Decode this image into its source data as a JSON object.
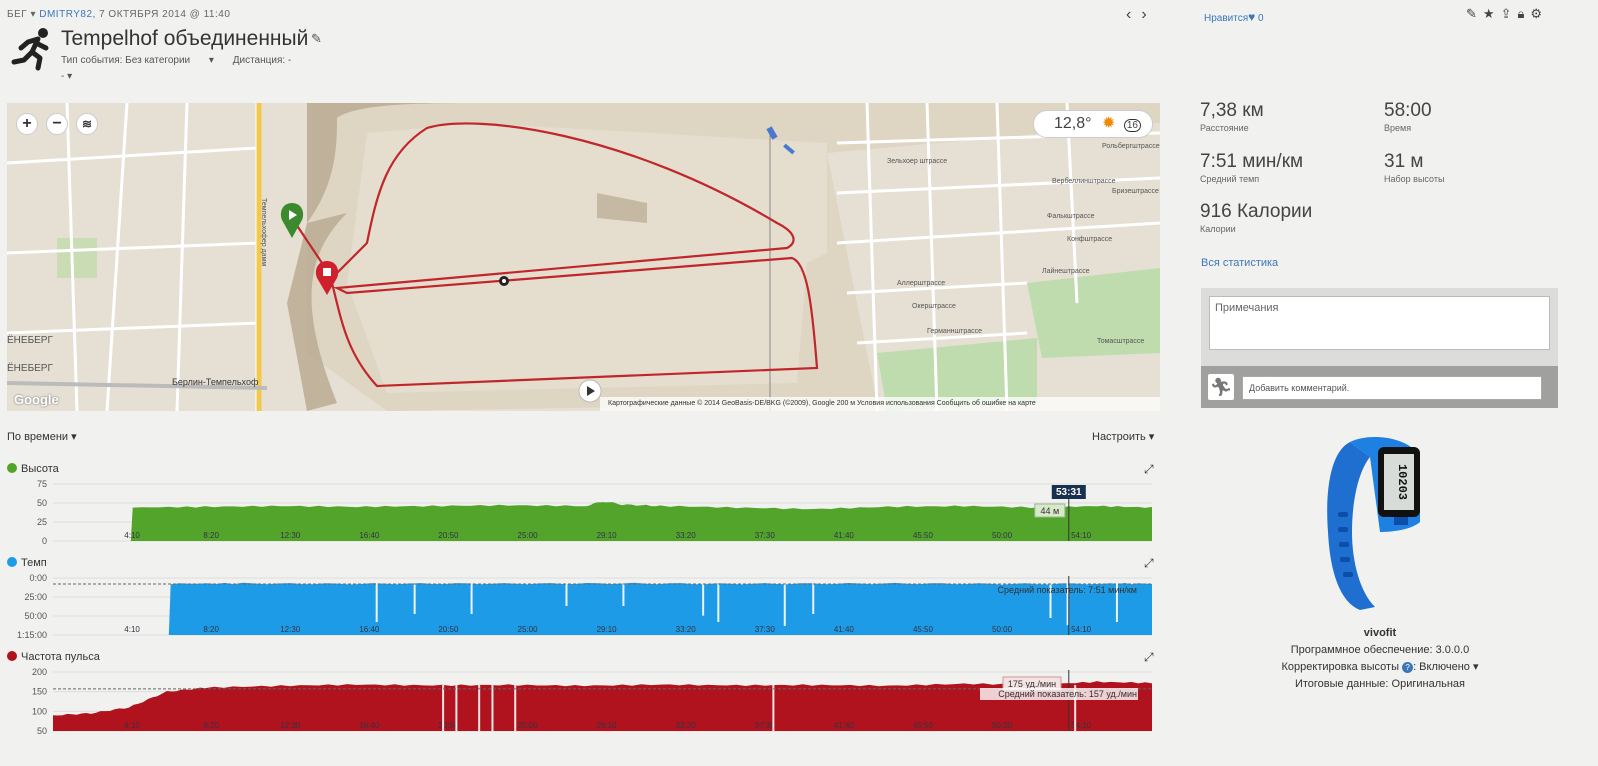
{
  "header": {
    "activity_type": "БЕГ",
    "user": "DMITRY82",
    "date": ", 7 ОКТЯБРЯ 2014 @ 11:40",
    "title": "Tempelhof объединенный",
    "event_type": "Тип события: Без категории",
    "distance_label": "Дистанция: -",
    "extra": "-",
    "likes_label": "Нравится",
    "likes_count": "0"
  },
  "map": {
    "temperature": "12,8°",
    "wind": "16",
    "footer": "Картографические данные © 2014 GeoBasis-DE/BKG (©2009), Google     200 м          Условия использования     Сообщить об ошибке на карте",
    "google": "Google",
    "labels": {
      "tempelhof": "Берлин-Темпельхоф",
      "schoeneberg1": "ЁНЕБЕРГ",
      "schoeneberg2": "ЁНЕБЕРГ",
      "street1": "Зельхоер штрассе",
      "street2": "Вербеллинштрассе",
      "street3": "Фалькштрассе",
      "street4": "Конфштрассе",
      "street5": "Лайнештрассе",
      "street6": "Аллерштрассе",
      "street7": "Окерштрассе",
      "street8": "Германнштрассе",
      "street9": "Томасштрассе",
      "street10": "Бризештрассе",
      "street11": "Рольбергштрассе",
      "street12": "Темпельхофер дамм"
    }
  },
  "stats": {
    "distance": {
      "value": "7,38 км",
      "label": "Расстояние"
    },
    "time": {
      "value": "58:00",
      "label": "Время"
    },
    "pace": {
      "value": "7:51 мин/км",
      "label": "Средний темп"
    },
    "ascent": {
      "value": "31 м",
      "label": "Набор высоты"
    },
    "calories": {
      "value": "916 Калории",
      "label": "Калории"
    },
    "all_stats_link": "Вся статистика"
  },
  "notes": {
    "placeholder": "Примечания",
    "comment_placeholder": "Добавить комментарий."
  },
  "device": {
    "name": "vivofit",
    "screen_text": "10203",
    "firmware": "Программное обеспечение: 3.0.0.0",
    "elevation_correction": "Корректировка высоты",
    "elevation_correction_value": ": Включено",
    "final_data": "Итоговые данные: Оригинальная"
  },
  "charts_controls": {
    "by_time": "По времени",
    "customize": "Настроить"
  },
  "chart_data": [
    {
      "type": "area",
      "title": "Высота",
      "color": "#52a52a",
      "yticks": [
        "75",
        "50",
        "25",
        "0"
      ],
      "ylim": [
        0,
        75
      ],
      "xticks": [
        "4:10",
        "8:20",
        "12:30",
        "16:40",
        "20:50",
        "25:00",
        "29:10",
        "33:20",
        "37:30",
        "41:40",
        "45:50",
        "50:00",
        "54:10"
      ],
      "x_minutes": [
        0,
        4.1,
        4.2,
        8,
        12,
        16,
        20,
        24,
        28,
        29,
        30,
        32,
        36,
        40,
        44,
        48,
        52,
        55,
        57.9
      ],
      "values": [
        0,
        0,
        44,
        45,
        46,
        45,
        46,
        47,
        46,
        52,
        48,
        46,
        44,
        42,
        45,
        46,
        44,
        46,
        44
      ],
      "cursor_time": "53:31",
      "cursor_value": "44 м"
    },
    {
      "type": "area",
      "title": "Темп",
      "color": "#1e9be6",
      "yticks": [
        "0:00",
        "25:00",
        "50:00",
        "1:15:00"
      ],
      "ylim_minutes_per_km": [
        0,
        75
      ],
      "xticks": [
        "4:10",
        "8:20",
        "12:30",
        "16:40",
        "20:50",
        "25:00",
        "29:10",
        "33:20",
        "37:30",
        "41:40",
        "45:50",
        "50:00",
        "54:10"
      ],
      "x_minutes": [
        0,
        6.1,
        6.2,
        10,
        15,
        20,
        25,
        30,
        35,
        40,
        45,
        50,
        55,
        57.9
      ],
      "values_min_per_km": [
        75,
        75,
        7.5,
        7.2,
        7.8,
        7.4,
        7.6,
        7.1,
        7.7,
        7.5,
        7.3,
        7.9,
        7.6,
        7.4
      ],
      "average_label": "Средний показатель: 7:51 мин/км",
      "average_value": 7.85
    },
    {
      "type": "area",
      "title": "Частота пульса",
      "color": "#b0131e",
      "yticks": [
        "200",
        "150",
        "100",
        "50"
      ],
      "ylim": [
        50,
        200
      ],
      "xticks": [
        "4:10",
        "8:20",
        "12:30",
        "16:40",
        "20:50",
        "25:00",
        "29:10",
        "33:20",
        "37:30",
        "41:40",
        "45:50",
        "50:00",
        "54:10"
      ],
      "x_minutes": [
        0,
        2,
        4,
        6,
        8,
        12,
        16,
        20,
        24,
        28,
        32,
        36,
        40,
        44,
        48,
        52,
        55,
        57.9
      ],
      "values": [
        90,
        95,
        110,
        150,
        160,
        165,
        168,
        166,
        167,
        165,
        168,
        166,
        167,
        165,
        170,
        168,
        175,
        172
      ],
      "cursor_value": "175 уд./мин",
      "average_label": "Средний показатель: 157 уд./мин",
      "average_value": 157
    }
  ]
}
